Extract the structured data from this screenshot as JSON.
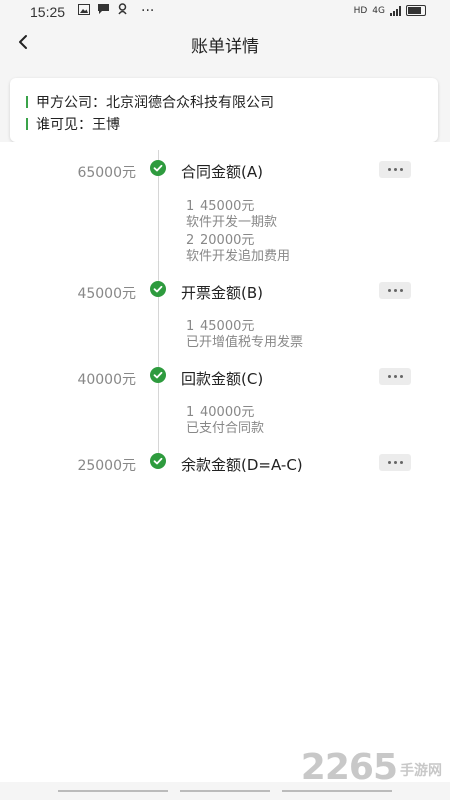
{
  "status_bar": {
    "time": "15:25",
    "dots": "···",
    "hd": "HD",
    "net": "4G"
  },
  "header": {
    "title": "账单详情"
  },
  "info": {
    "party_a": "甲方公司：北京润德合众科技有限公司",
    "visible_to": "谁可见：王博"
  },
  "items": [
    {
      "amount": "65000元",
      "title": "合同金额(A)",
      "details": [
        {
          "idx": "1",
          "amount": "45000元",
          "desc": "软件开发一期款"
        },
        {
          "idx": "2",
          "amount": "20000元",
          "desc": "软件开发追加费用"
        }
      ]
    },
    {
      "amount": "45000元",
      "title": "开票金额(B)",
      "details": [
        {
          "idx": "1",
          "amount": "45000元",
          "desc": "已开增值税专用发票"
        }
      ]
    },
    {
      "amount": "40000元",
      "title": "回款金额(C)",
      "details": [
        {
          "idx": "1",
          "amount": "40000元",
          "desc": "已支付合同款"
        }
      ]
    },
    {
      "amount": "25000元",
      "title": "余款金额(D=A-C)",
      "details": []
    }
  ],
  "watermark": {
    "number": "2265",
    "text": "手游网"
  },
  "colors": {
    "accent": "#2e9b3e",
    "text": "#222222",
    "muted": "#888888"
  }
}
